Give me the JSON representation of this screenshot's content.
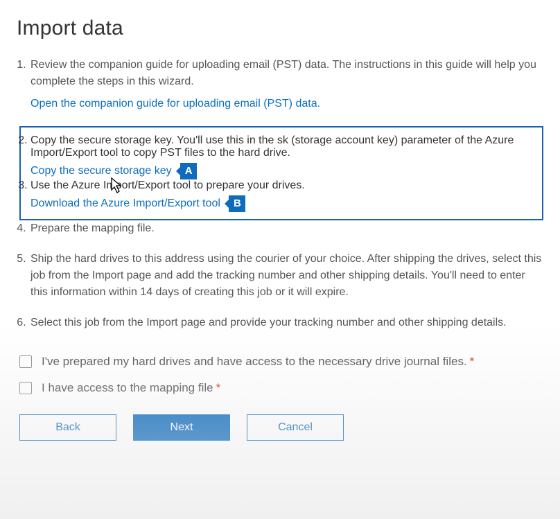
{
  "title": "Import data",
  "steps": {
    "s1": {
      "text": "Review the companion guide for uploading email (PST) data. The instructions in this guide will help you complete the steps in this wizard.",
      "link": "Open the companion guide for uploading email (PST) data."
    },
    "s2": {
      "text": "Copy the secure storage key. You'll use this in the sk (storage account key) parameter of the Azure Import/Export tool to copy PST files to the hard drive.",
      "link": "Copy the secure storage key",
      "badge": "A"
    },
    "s3": {
      "text": "Use the Azure Import/Export tool to prepare your drives.",
      "link": "Download the Azure Import/Export tool",
      "badge": "B"
    },
    "s4": {
      "text": "Prepare the mapping file."
    },
    "s5": {
      "text": "Ship the hard drives to this address using the courier of your choice. After shipping the drives, select this job from the Import page and add the tracking number and other shipping details. You'll need to enter this information within 14 days of creating this job or it will expire."
    },
    "s6": {
      "text": "Select this job from the Import page and provide your tracking number and other shipping details."
    }
  },
  "checkboxes": {
    "c1": "I've prepared my hard drives and have access to the necessary drive journal files.",
    "c2": "I have access to the mapping file"
  },
  "buttons": {
    "back": "Back",
    "next": "Next",
    "cancel": "Cancel"
  }
}
